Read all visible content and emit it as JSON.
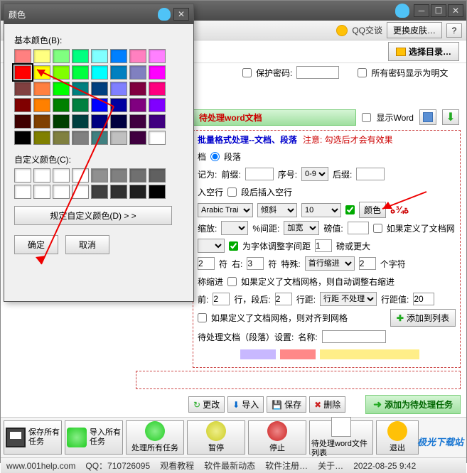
{
  "main": {
    "toolbar": {
      "qq_label": "QQ交谈",
      "skin_btn": "更换皮肤…",
      "help": "?"
    },
    "select_dir_btn": "选择目录…",
    "protect": {
      "label": "保护密码:",
      "plaintext": "所有密码显示为明文"
    },
    "word_row": {
      "label": "待处理word文档",
      "show_word": "显示Word"
    },
    "format": {
      "title_blue": "批量格式处理--文档、段落",
      "title_red": "注意: 勾选后才会有效果",
      "row1": {
        "dang": "档",
        "para": "段落"
      },
      "row2": {
        "jiwei": "记为:",
        "prefix": "前缀:",
        "seq": "序号:",
        "seq_val": "0-9",
        "suffix": "后缀:"
      },
      "row3": {
        "space": "入空行",
        "after": "段后插入空行"
      },
      "row4": {
        "font_val": "Arabic Trai",
        "style_val": "倾斜",
        "size_val": "10",
        "color_btn": "颜色",
        "annot": "ﺓ¾ﻩ"
      },
      "row5": {
        "zoom": "缩放:",
        "pct": "%间距:",
        "widen_val": "加宽",
        "exact": "磅值:",
        "grid": "如果定义了文档网"
      },
      "row6": {
        "adjust": "为字体调整字间距",
        "poundormore": "磅或更大"
      },
      "row7": {
        "char_label": "符",
        "right": "右:",
        "right_val": "3",
        "char2": "符",
        "special": "特殊:",
        "special_val": "首行缩进",
        "count_val": "2",
        "unit": "个字符"
      },
      "row8": {
        "indent": "称缩进",
        "grid_auto": "如果定义了文档网格，则自动调整右缩进"
      },
      "row9": {
        "before": "前:",
        "before_val": "2",
        "line1": "行，段后:",
        "after_val": "2",
        "spacing": "行距:",
        "spacing_val": "行距 不处理",
        "value": "行距值:",
        "value_val": "20"
      },
      "row10": {
        "grid_align": "如果定义了文档网格，则对齐到网格"
      },
      "row7_left_val": "2"
    },
    "pending": {
      "label": "待处理文档（段落）设置:",
      "name": "名称:",
      "add_list": "添加到列表"
    },
    "actions": {
      "change": "更改",
      "import": "导入",
      "save": "保存",
      "delete": "删除",
      "add_task": "添加为待处理任务"
    },
    "bottom": {
      "save_all": "保存所有任务",
      "import_all": "导入所有任务",
      "process_all": "处理所有任务",
      "pause": "暂停",
      "stop": "停止",
      "word_list": "待处理word文件列表",
      "exit": "退出"
    },
    "status": {
      "url": "www.001help.com",
      "qq": "QQ：710726095",
      "tutorial": "观看教程",
      "news": "软件最新动态",
      "reg": "软件注册…",
      "about": "关于…",
      "time": "2022-08-25 9:42"
    },
    "logo": "极光下载站"
  },
  "color_dialog": {
    "title": "颜色",
    "basic_label": "基本颜色(B):",
    "custom_label": "自定义颜色(C):",
    "define_btn": "规定自定义颜色(D) > >",
    "ok": "确定",
    "cancel": "取消",
    "basic_colors": [
      "#ff8080",
      "#ffff80",
      "#80ff80",
      "#00ff80",
      "#80ffff",
      "#0080ff",
      "#ff80c0",
      "#ff80ff",
      "#ff0000",
      "#ffff00",
      "#80ff00",
      "#00ff40",
      "#00ffff",
      "#0080c0",
      "#8080c0",
      "#ff00ff",
      "#804040",
      "#ff8040",
      "#00ff00",
      "#008080",
      "#004080",
      "#8080ff",
      "#800040",
      "#ff0080",
      "#800000",
      "#ff8000",
      "#008000",
      "#008040",
      "#0000ff",
      "#0000a0",
      "#800080",
      "#8000ff",
      "#400000",
      "#804000",
      "#004000",
      "#004040",
      "#000080",
      "#000040",
      "#400040",
      "#400080",
      "#000000",
      "#808000",
      "#808040",
      "#808080",
      "#408080",
      "#c0c0c0",
      "#400040",
      "#ffffff"
    ],
    "custom_colors": [
      "#ffffff",
      "#ffffff",
      "#ffffff",
      "#ffffff",
      "#909090",
      "#808080",
      "#707070",
      "#606060",
      "#ffffff",
      "#ffffff",
      "#ffffff",
      "#ffffff",
      "#404040",
      "#303030",
      "#202020",
      "#000000"
    ]
  }
}
